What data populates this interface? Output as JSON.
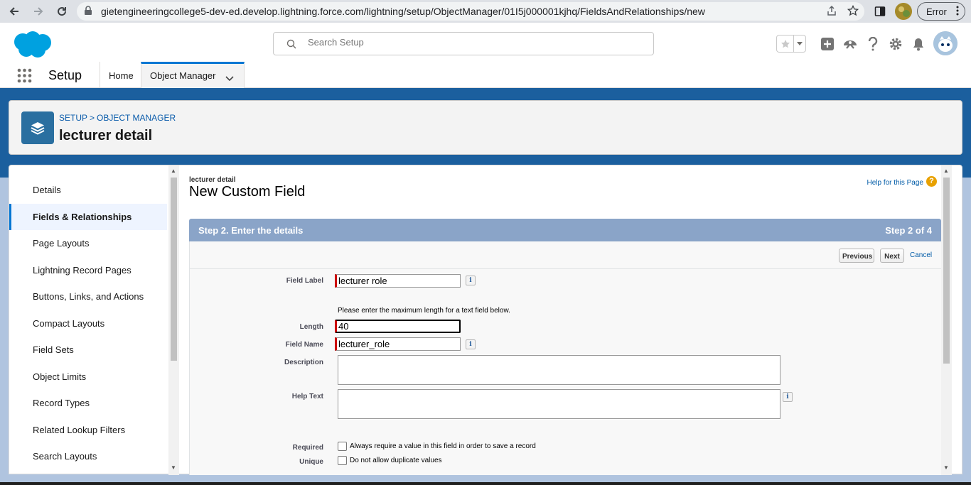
{
  "browser": {
    "url": "gietengineeringcollege5-dev-ed.develop.lightning.force.com/lightning/setup/ObjectManager/01I5j000001kjhq/FieldsAndRelationships/new",
    "error_label": "Error"
  },
  "header": {
    "search_placeholder": "Search Setup"
  },
  "nav": {
    "app_name": "Setup",
    "tabs": [
      {
        "label": "Home"
      },
      {
        "label": "Object Manager"
      }
    ]
  },
  "card": {
    "breadcrumb": [
      "Setup",
      "Object Manager"
    ],
    "title": "lecturer detail"
  },
  "sidebar": {
    "items": [
      {
        "label": "Details"
      },
      {
        "label": "Fields & Relationships"
      },
      {
        "label": "Page Layouts"
      },
      {
        "label": "Lightning Record Pages"
      },
      {
        "label": "Buttons, Links, and Actions"
      },
      {
        "label": "Compact Layouts"
      },
      {
        "label": "Field Sets"
      },
      {
        "label": "Object Limits"
      },
      {
        "label": "Record Types"
      },
      {
        "label": "Related Lookup Filters"
      },
      {
        "label": "Search Layouts"
      }
    ],
    "active_index": 1
  },
  "content": {
    "object_name": "lecturer detail",
    "page_title": "New Custom Field",
    "help_link": "Help for this Page",
    "step_title": "Step 2. Enter the details",
    "step_count": "Step 2 of 4",
    "buttons": {
      "previous": "Previous",
      "next": "Next",
      "cancel": "Cancel"
    },
    "form": {
      "field_label": {
        "label": "Field Label",
        "value": "lecturer role"
      },
      "length_hint": "Please enter the maximum length for a text field below.",
      "length": {
        "label": "Length",
        "value": "40"
      },
      "field_name": {
        "label": "Field Name",
        "value": "lecturer_role"
      },
      "description": {
        "label": "Description",
        "value": ""
      },
      "help_text": {
        "label": "Help Text",
        "value": ""
      },
      "required": {
        "label": "Required",
        "text": "Always require a value in this field in order to save a record",
        "checked": false
      },
      "unique": {
        "label": "Unique",
        "text": "Do not allow duplicate values",
        "checked": false
      }
    }
  },
  "colors": {
    "brand_blue": "#0176d3",
    "step_bar": "#8aa4c8",
    "required_marker": "#cc0000"
  }
}
